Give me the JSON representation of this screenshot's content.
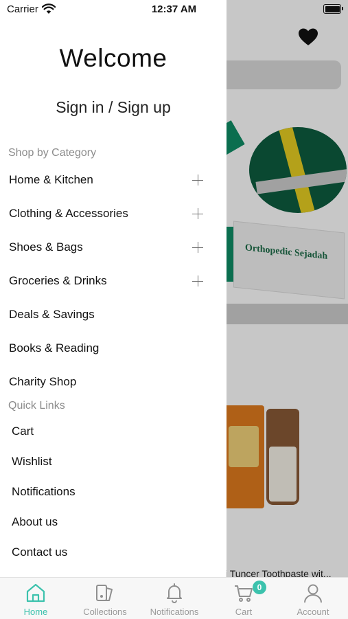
{
  "status_bar": {
    "carrier": "Carrier",
    "time": "12:37 AM"
  },
  "background": {
    "box_text": "Orthopedic Sejadah",
    "product_caption": "i Tuncer Toothpaste wit..."
  },
  "drawer": {
    "welcome": "Welcome",
    "signin": "Sign in / Sign up",
    "shop_by_category_title": "Shop by Category",
    "categories": [
      {
        "label": "Home & Kitchen",
        "expandable": true
      },
      {
        "label": "Clothing & Accessories",
        "expandable": true
      },
      {
        "label": "Shoes & Bags",
        "expandable": true
      },
      {
        "label": "Groceries & Drinks",
        "expandable": true
      },
      {
        "label": "Deals & Savings",
        "expandable": false
      },
      {
        "label": "Books & Reading",
        "expandable": false
      },
      {
        "label": "Charity Shop",
        "expandable": false
      }
    ],
    "quick_links_title": "Quick Links",
    "quick_links": [
      "Cart",
      "Wishlist",
      "Notifications",
      "About us",
      "Contact us"
    ]
  },
  "tabbar": {
    "tabs": [
      {
        "label": "Home",
        "icon": "home-icon",
        "active": true
      },
      {
        "label": "Collections",
        "icon": "collections-icon",
        "active": false
      },
      {
        "label": "Notifications",
        "icon": "bell-icon",
        "active": false
      },
      {
        "label": "Cart",
        "icon": "cart-icon",
        "active": false,
        "badge": "0"
      },
      {
        "label": "Account",
        "icon": "person-icon",
        "active": false
      }
    ]
  },
  "colors": {
    "accent": "#3cc2ad",
    "inactive": "#9a9a9a",
    "section_title": "#8c8c8c"
  }
}
